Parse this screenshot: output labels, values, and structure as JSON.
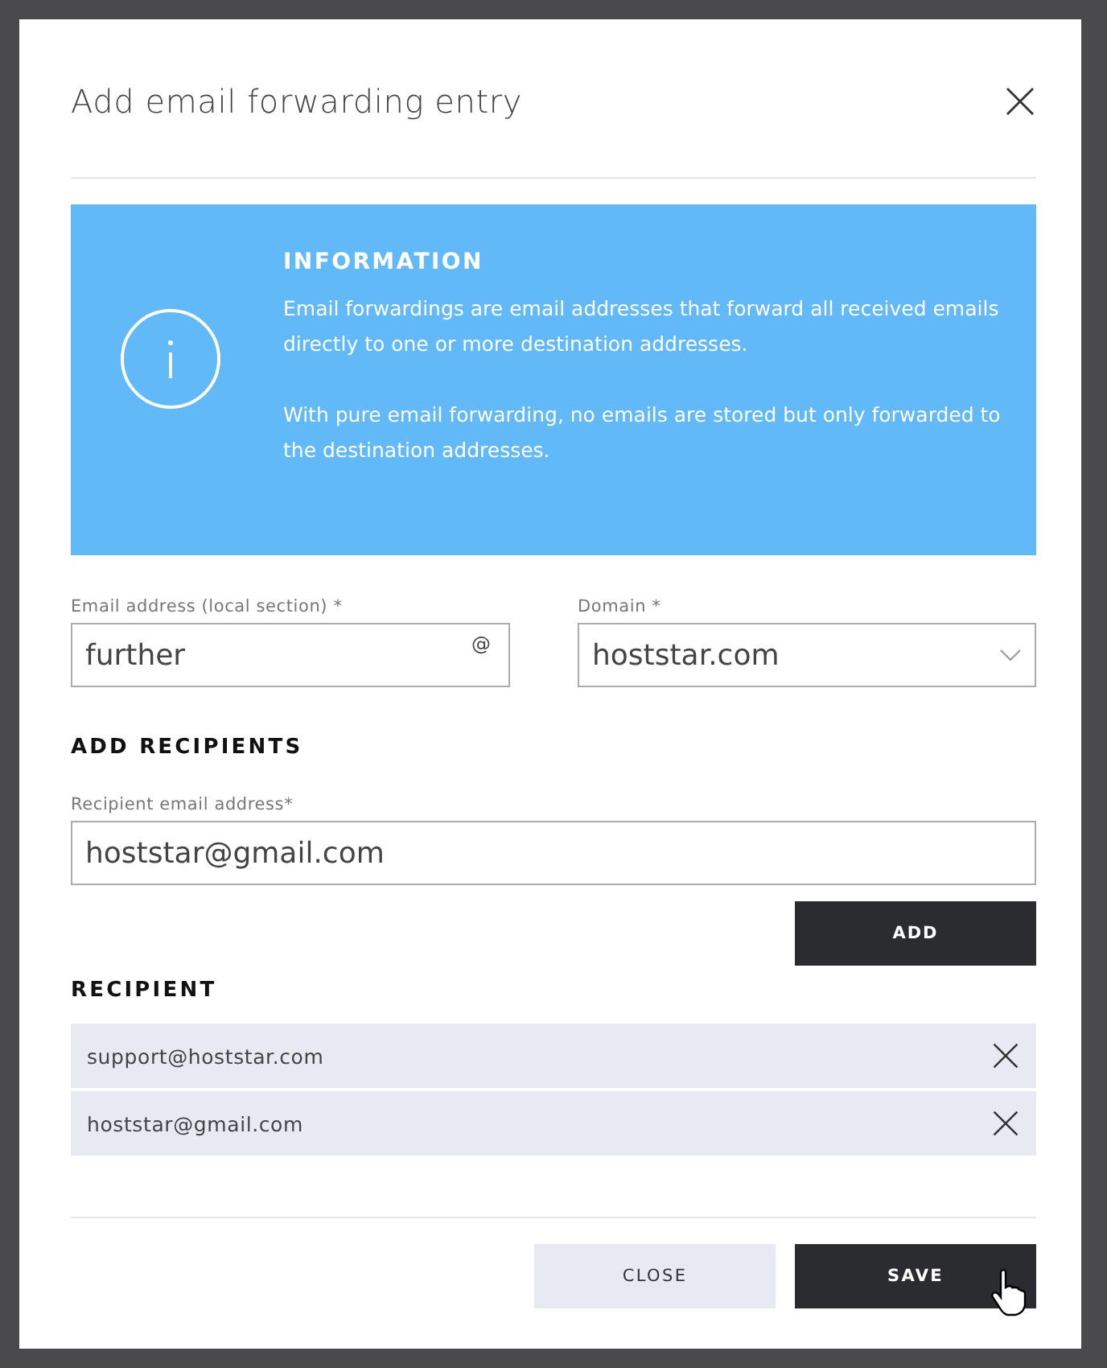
{
  "dialog": {
    "title": "Add email forwarding entry"
  },
  "info": {
    "heading": "INFORMATION",
    "paragraphs": [
      "Email forwardings are email addresses that forward all received emails directly to one or more destination addresses.",
      "With pure email forwarding, no emails are stored but only forwarded to the destination addresses."
    ]
  },
  "fields": [
    {
      "kind": "text",
      "label": "Email address (local section) *",
      "value": "further",
      "suffix": "@"
    },
    {
      "kind": "select",
      "label": "Domain *",
      "value": "hoststar.com"
    }
  ],
  "add_recipients": {
    "heading": "ADD RECIPIENTS",
    "label": "Recipient email address*",
    "value": "hoststar@gmail.com",
    "button": "ADD"
  },
  "recipients": {
    "heading": "RECIPIENT",
    "items": [
      "support@hoststar.com",
      "hoststar@gmail.com"
    ]
  },
  "buttons": [
    {
      "kind": "secondary",
      "label": "CLOSE"
    },
    {
      "kind": "primary",
      "label": "SAVE"
    }
  ]
}
